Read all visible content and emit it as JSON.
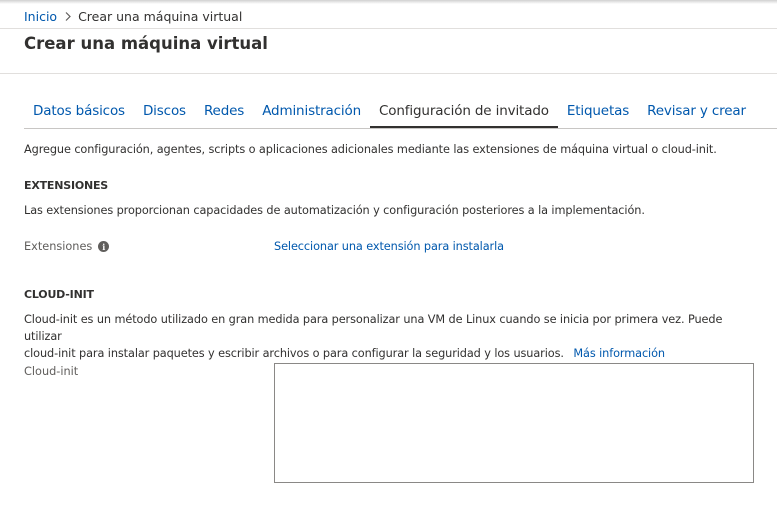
{
  "breadcrumb": {
    "home_label": "Inicio",
    "current_label": "Crear una máquina virtual"
  },
  "page": {
    "title": "Crear una máquina virtual"
  },
  "tabs": [
    {
      "label": "Datos básicos",
      "active": false
    },
    {
      "label": "Discos",
      "active": false
    },
    {
      "label": "Redes",
      "active": false
    },
    {
      "label": "Administración",
      "active": false
    },
    {
      "label": "Configuración de invitado",
      "active": true
    },
    {
      "label": "Etiquetas",
      "active": false
    },
    {
      "label": "Revisar y crear",
      "active": false
    }
  ],
  "intro_text": "Agregue configuración, agentes, scripts o aplicaciones adicionales mediante las extensiones de máquina virtual o cloud-init.",
  "extensions": {
    "heading": "EXTENSIONES",
    "description": "Las extensiones proporcionan capacidades de automatización y configuración posteriores a la implementación.",
    "field_label": "Extensiones",
    "info_icon": "info-icon",
    "select_link": "Seleccionar una extensión para instalarla"
  },
  "cloud_init": {
    "heading": "CLOUD-INIT",
    "description_line1": "Cloud-init es un método utilizado en gran medida para personalizar una VM de Linux cuando se inicia por primera vez. Puede utilizar",
    "description_line2": "cloud-init para instalar paquetes y escribir archivos o para configurar la seguridad y los usuarios.",
    "more_info_link": "Más información",
    "field_label": "Cloud-init",
    "value": ""
  },
  "colors": {
    "link": "#0058ad",
    "text": "#323130",
    "label": "#605e5c",
    "border": "#8a8886"
  }
}
